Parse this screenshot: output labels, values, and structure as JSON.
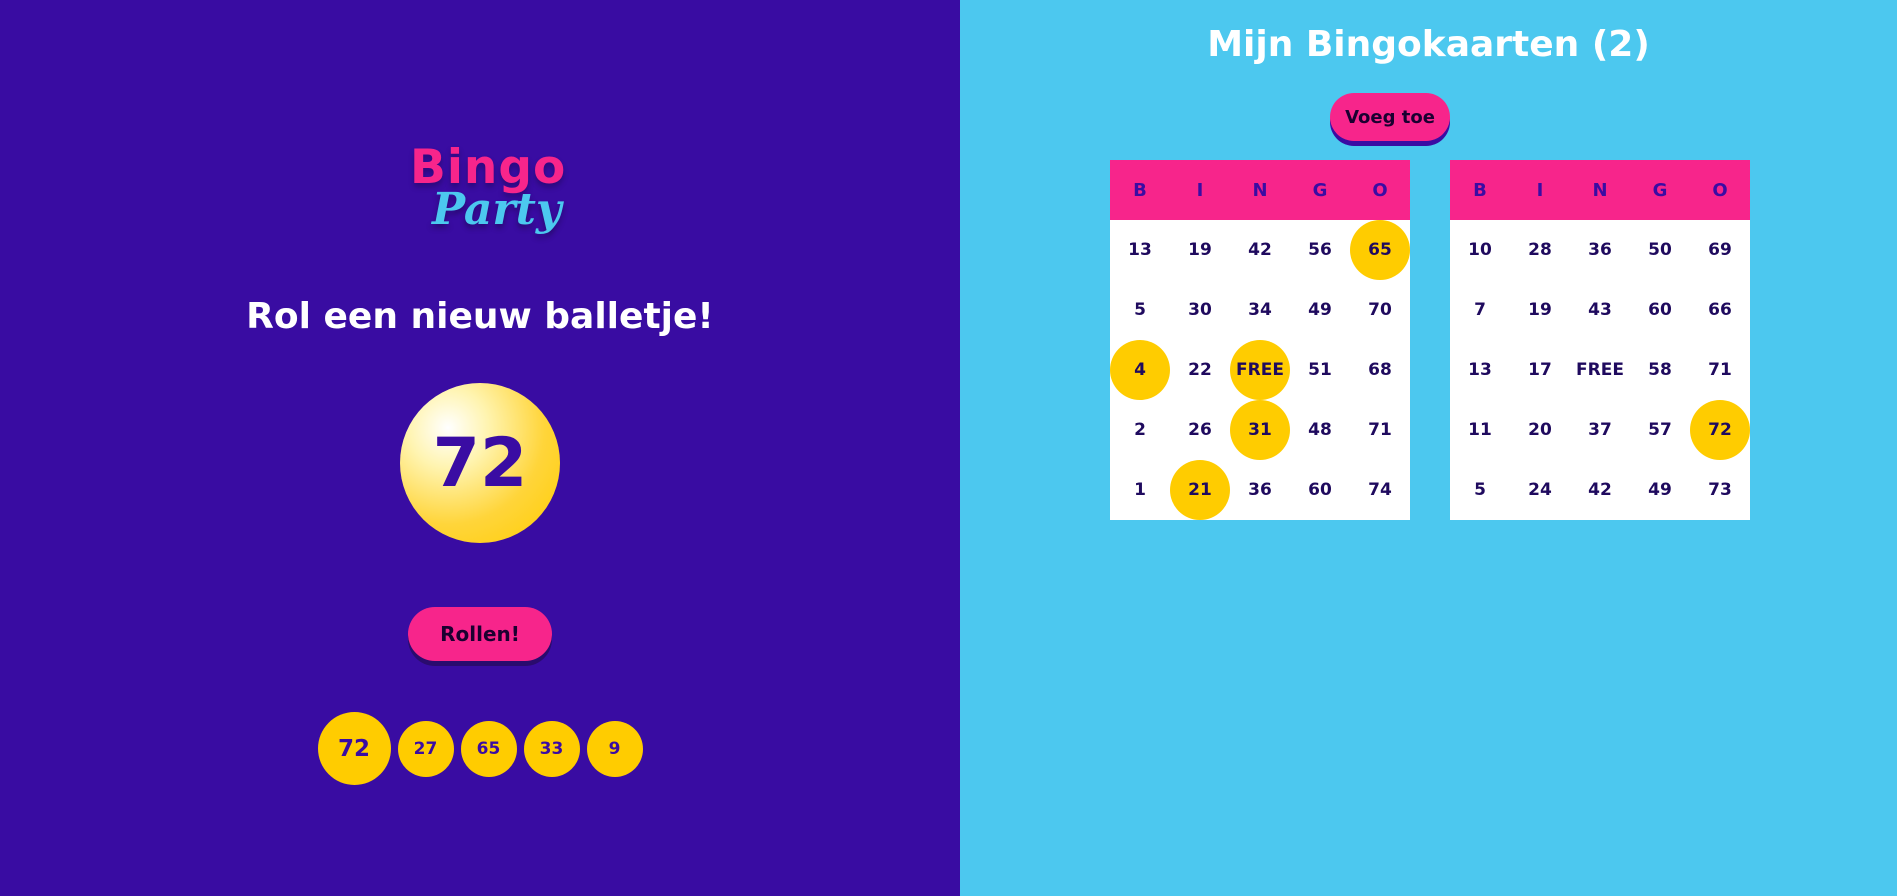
{
  "logo": {
    "line1": "Bingo",
    "line2": "Party"
  },
  "roll_panel": {
    "headline": "Rol een nieuw balletje!",
    "current_ball": "72",
    "roll_button": "Rollen!",
    "history": [
      "72",
      "27",
      "65",
      "33",
      "9"
    ]
  },
  "cards_panel": {
    "title": "Mijn Bingokaarten (2)",
    "add_button": "Voeg toe",
    "columns": [
      "B",
      "I",
      "N",
      "G",
      "O"
    ],
    "cards": [
      {
        "rows": [
          [
            "13",
            "19",
            "42",
            "56",
            "65"
          ],
          [
            "5",
            "30",
            "34",
            "49",
            "70"
          ],
          [
            "4",
            "22",
            "FREE",
            "51",
            "68"
          ],
          [
            "2",
            "26",
            "31",
            "48",
            "71"
          ],
          [
            "1",
            "21",
            "36",
            "60",
            "74"
          ]
        ],
        "marked": [
          [
            0,
            4
          ],
          [
            2,
            0
          ],
          [
            2,
            2
          ],
          [
            3,
            2
          ],
          [
            4,
            1
          ]
        ]
      },
      {
        "rows": [
          [
            "10",
            "28",
            "36",
            "50",
            "69"
          ],
          [
            "7",
            "19",
            "43",
            "60",
            "66"
          ],
          [
            "13",
            "17",
            "FREE",
            "58",
            "71"
          ],
          [
            "11",
            "20",
            "37",
            "57",
            "72"
          ],
          [
            "5",
            "24",
            "42",
            "49",
            "73"
          ]
        ],
        "marked": [
          [
            3,
            4
          ]
        ]
      }
    ]
  },
  "colors": {
    "left_bg": "#390ca2",
    "right_bg": "#4cc8ef",
    "accent_pink": "#f7258b",
    "ball_yellow": "#ffcc00",
    "text_purple": "#3a0ca3"
  }
}
